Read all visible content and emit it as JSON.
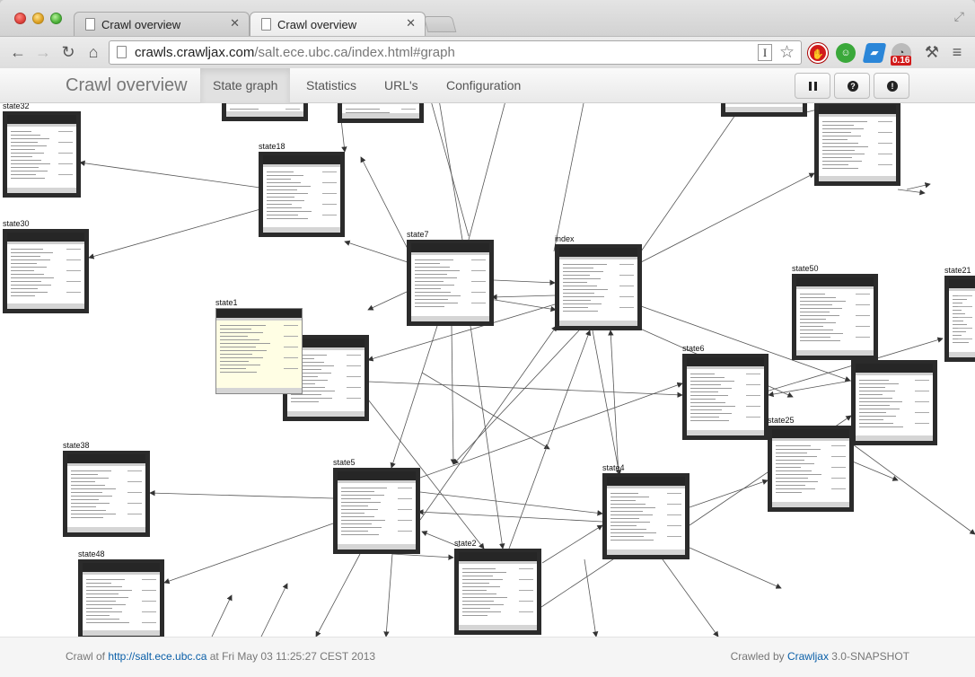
{
  "browser": {
    "tabs": [
      {
        "title": "Crawl overview",
        "active": false
      },
      {
        "title": "Crawl overview",
        "active": true
      }
    ],
    "url_host": "crawls.crawljax.com",
    "url_path": "/salt.ece.ubc.ca/index.html#graph",
    "reader_label": "I",
    "extension_badge": "0.16",
    "icons": [
      "back-icon",
      "forward-icon",
      "reload-icon",
      "home-icon",
      "star-icon",
      "wrench-icon",
      "menu-icon"
    ]
  },
  "app": {
    "brand": "Crawl overview",
    "nav": [
      {
        "label": "State graph",
        "active": true
      },
      {
        "label": "Statistics",
        "active": false
      },
      {
        "label": "URL's",
        "active": false
      },
      {
        "label": "Configuration",
        "active": false
      }
    ],
    "controls": [
      "pause-icon",
      "help-icon",
      "stop-icon"
    ]
  },
  "graph": {
    "nodes": [
      "state32",
      "state18",
      "state30",
      "state7",
      "index",
      "state50",
      "state21",
      "state1",
      "state6",
      "state25",
      "state38",
      "state5",
      "state4",
      "state2",
      "state48"
    ]
  },
  "footer": {
    "prefix": "Crawl of ",
    "link": "http://salt.ece.ubc.ca",
    "suffix": " at Fri May 03 11:25:27 CEST 2013",
    "crawled_by": "Crawled by ",
    "crawljax": "Crawljax",
    "version": " 3.0-SNAPSHOT"
  },
  "colors": {
    "link": "#0a5fa8",
    "nav_active_bg": "#e1e1e1",
    "thumb_frame": "#2b2b2b"
  }
}
